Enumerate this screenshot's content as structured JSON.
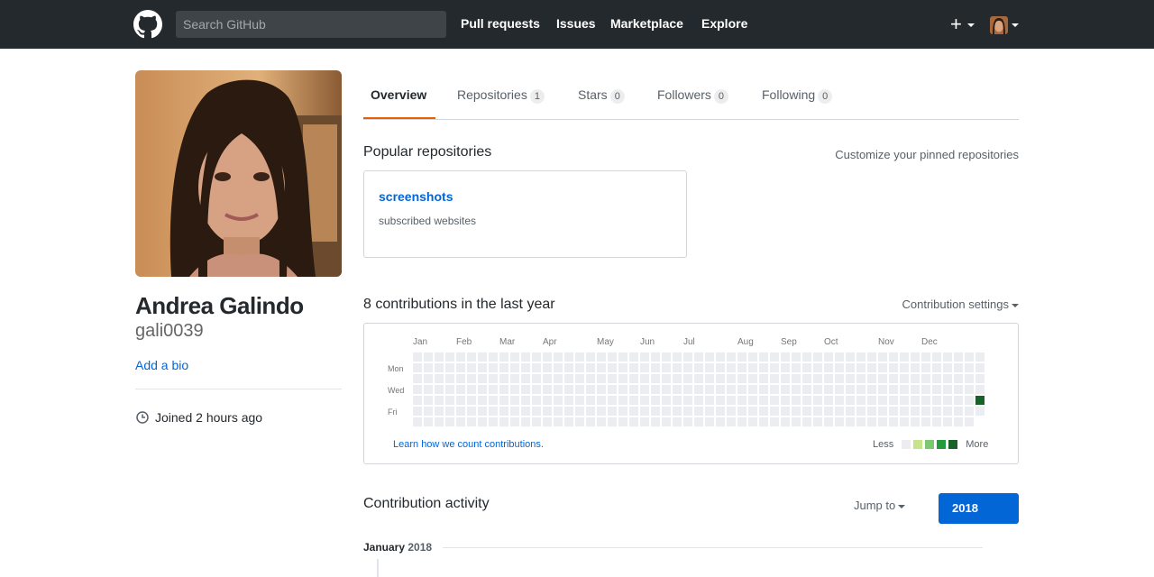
{
  "header": {
    "search_placeholder": "Search GitHub",
    "nav": [
      "Pull requests",
      "Issues",
      "Marketplace",
      "Explore"
    ],
    "plus": "+"
  },
  "profile": {
    "full_name": "Andrea Galindo",
    "username": "gali0039",
    "add_bio": "Add a bio",
    "joined": "Joined 2 hours ago"
  },
  "tabs": [
    {
      "label": "Overview",
      "count": null
    },
    {
      "label": "Repositories",
      "count": "1"
    },
    {
      "label": "Stars",
      "count": "0"
    },
    {
      "label": "Followers",
      "count": "0"
    },
    {
      "label": "Following",
      "count": "0"
    }
  ],
  "pinned": {
    "title": "Popular repositories",
    "customize": "Customize your pinned repositories",
    "repos": [
      {
        "name": "screenshots",
        "description": "subscribed websites"
      }
    ]
  },
  "contributions": {
    "title": "8 contributions in the last year",
    "settings": "Contribution settings",
    "months": [
      "Jan",
      "Feb",
      "Mar",
      "Apr",
      "May",
      "Jun",
      "Jul",
      "Aug",
      "Sep",
      "Oct",
      "Nov",
      "Dec"
    ],
    "days": [
      "Mon",
      "Wed",
      "Fri"
    ],
    "learn": "Learn how we count contributions.",
    "legend_less": "Less",
    "legend_more": "More",
    "colors": [
      "#ebedf0",
      "#c6e48b",
      "#7bc96f",
      "#239a3b",
      "#196127"
    ],
    "active_cell": {
      "week": 52,
      "day": 4,
      "level": 4
    }
  },
  "activity": {
    "title": "Contribution activity",
    "jump": "Jump to",
    "year": "2018",
    "month": "January",
    "month_year": "2018"
  }
}
